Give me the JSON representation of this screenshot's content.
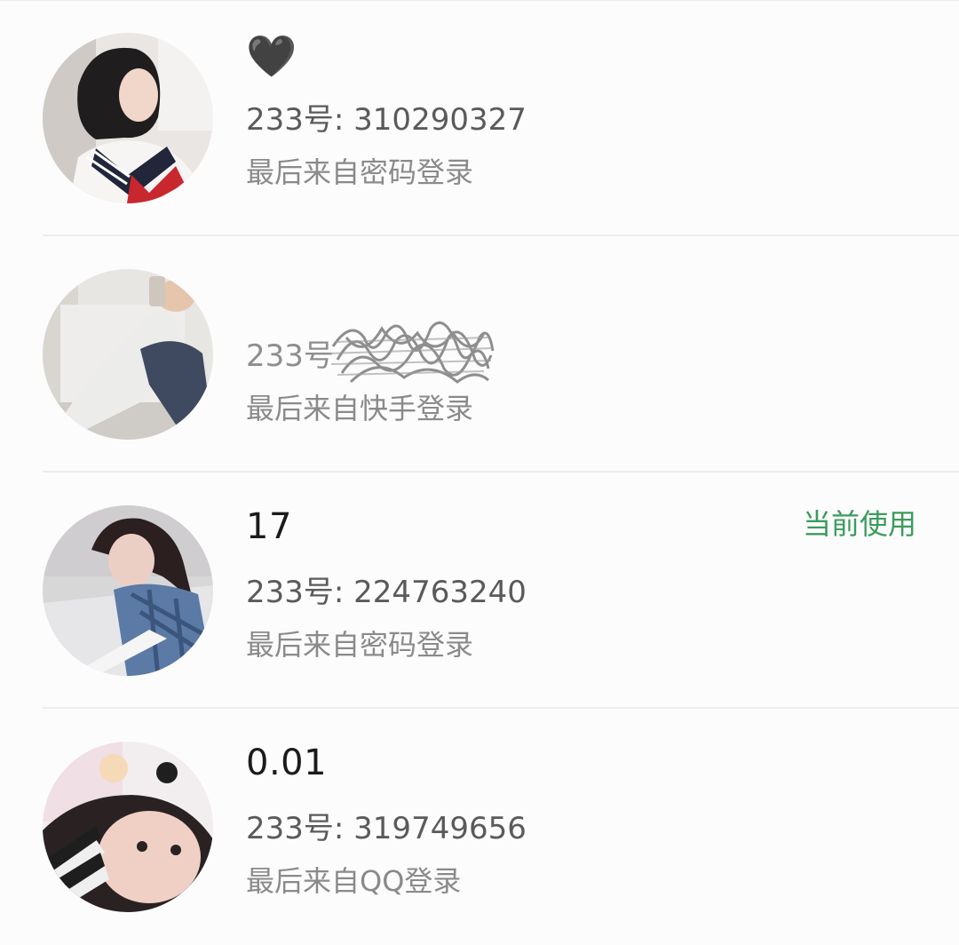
{
  "accounts": [
    {
      "nickname": "🖤",
      "id_prefix": "233号:",
      "id_value": "310290327",
      "last_login": "最后来自密码登录",
      "avatar_icon": "avatar-photo-sailor-uniform"
    },
    {
      "nickname": "",
      "id_prefix": "233号",
      "id_value": "",
      "last_login": "最后来自快手登录",
      "avatar_icon": "avatar-photo-sitting-person"
    },
    {
      "nickname": "17",
      "id_prefix": "233号:",
      "id_value": "224763240",
      "last_login": "最后来自密码登录",
      "avatar_icon": "avatar-photo-girl-plaid-shirt",
      "badge": "当前使用"
    },
    {
      "nickname": "0.01",
      "id_prefix": "233号:",
      "id_value": "319749656",
      "last_login": "最后来自QQ登录",
      "avatar_icon": "avatar-photo-child"
    }
  ],
  "colors": {
    "background": "#fdfcfd",
    "badge_green": "#3a9c5b",
    "divider": "#ececec"
  }
}
